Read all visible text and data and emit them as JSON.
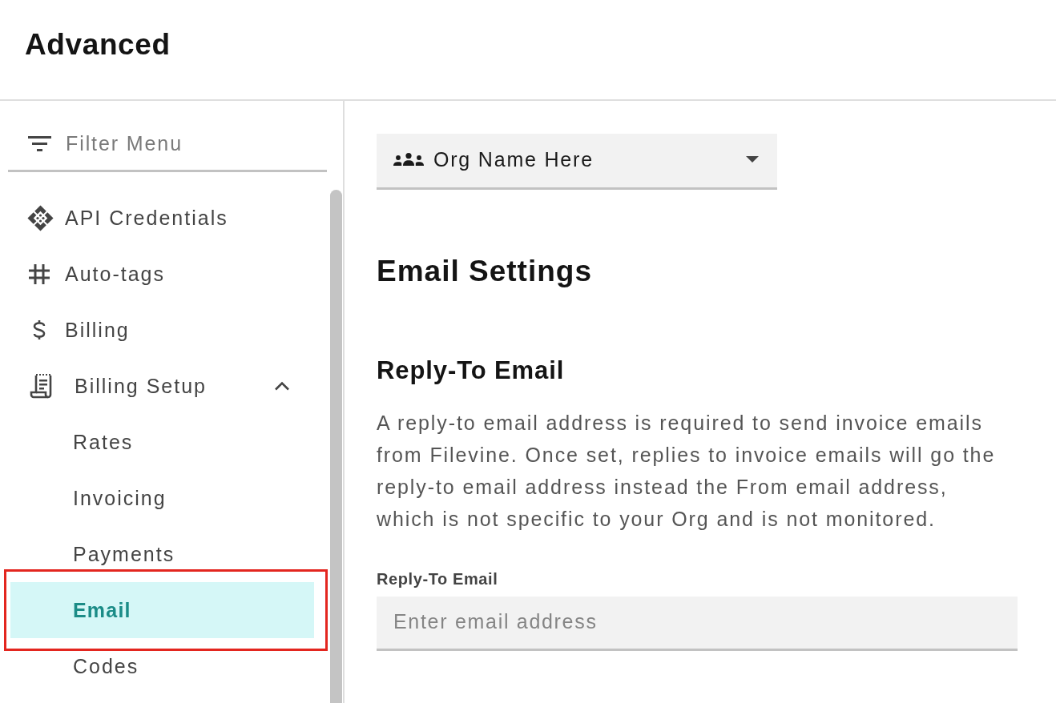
{
  "page": {
    "title": "Advanced"
  },
  "sidebar": {
    "filter": {
      "placeholder": "Filter Menu"
    },
    "items": [
      {
        "label": "API Credentials",
        "kind": "link",
        "selected": false,
        "highlighted": false
      },
      {
        "label": "Auto-tags",
        "kind": "link",
        "selected": false,
        "highlighted": false
      },
      {
        "label": "Billing",
        "kind": "link",
        "selected": false,
        "highlighted": false
      },
      {
        "label": "Billing Setup",
        "kind": "group",
        "selected": false,
        "highlighted": false,
        "expanded": true,
        "children": [
          {
            "label": "Rates",
            "selected": false,
            "highlighted": false
          },
          {
            "label": "Invoicing",
            "selected": false,
            "highlighted": false
          },
          {
            "label": "Payments",
            "selected": false,
            "highlighted": false
          },
          {
            "label": "Email",
            "selected": true,
            "highlighted": true
          },
          {
            "label": "Codes",
            "selected": false,
            "highlighted": false
          }
        ]
      }
    ]
  },
  "org_selector": {
    "value": "Org Name Here"
  },
  "email_settings": {
    "title": "Email Settings",
    "section": {
      "title": "Reply-To Email",
      "description": "A reply-to email address is required to send invoice emails from Filevine. Once set, replies to invoice emails will go the reply-to email address instead the From email address, which is not specific to your Org and is not monitored.",
      "field": {
        "label": "Reply-To Email",
        "placeholder": "Enter email address"
      }
    }
  }
}
